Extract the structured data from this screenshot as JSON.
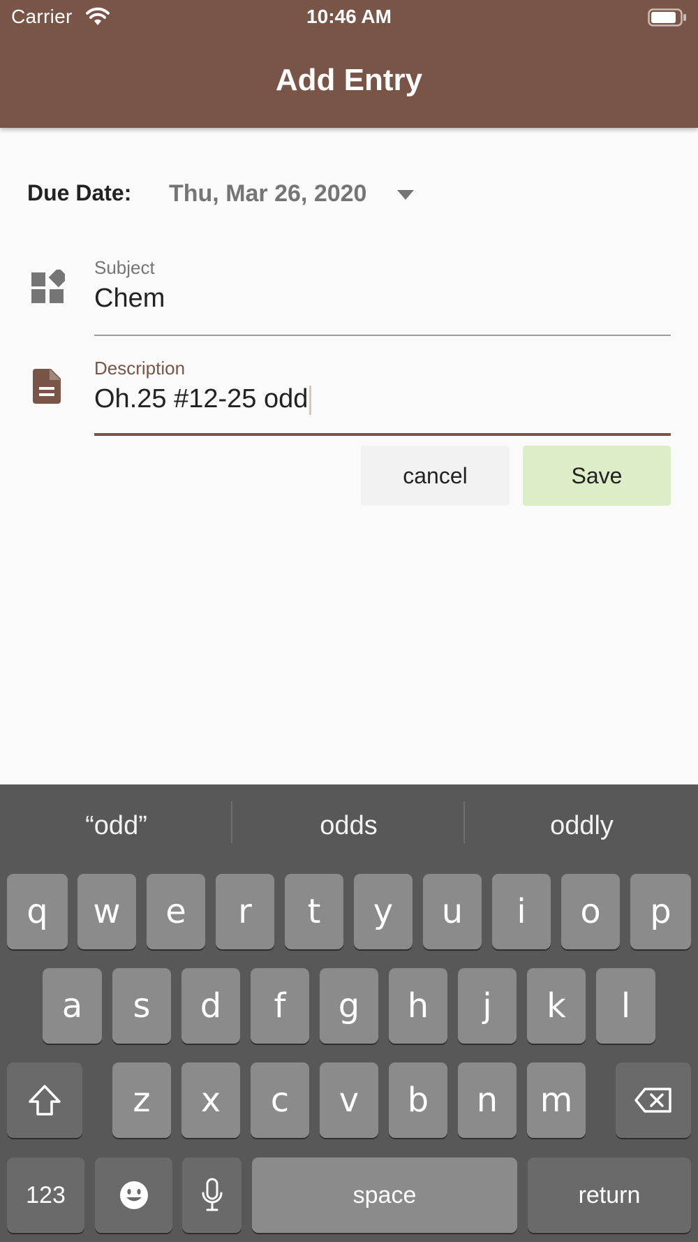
{
  "status_bar": {
    "carrier": "Carrier",
    "time": "10:46 AM"
  },
  "app_bar": {
    "title": "Add Entry",
    "background_color": "#795548"
  },
  "form": {
    "due_date": {
      "label": "Due Date:",
      "value": "Thu, Mar 26, 2020"
    },
    "subject": {
      "label": "Subject",
      "value": "Chem",
      "icon": "widgets-icon"
    },
    "description": {
      "label": "Description",
      "value": "Oh.25 #12-25 odd",
      "icon": "description-icon",
      "focused": true
    },
    "buttons": {
      "cancel": "cancel",
      "save": "Save"
    }
  },
  "keyboard": {
    "suggestions": [
      "“odd”",
      "odds",
      "oddly"
    ],
    "rows": [
      [
        "q",
        "w",
        "e",
        "r",
        "t",
        "y",
        "u",
        "i",
        "o",
        "p"
      ],
      [
        "a",
        "s",
        "d",
        "f",
        "g",
        "h",
        "j",
        "k",
        "l"
      ],
      [
        "z",
        "x",
        "c",
        "v",
        "b",
        "n",
        "m"
      ]
    ],
    "numbers_key": "123",
    "space_key": "space",
    "return_key": "return"
  },
  "colors": {
    "accent": "#795548",
    "save_button": "#dcedc8",
    "keyboard_bg": "#585858"
  }
}
